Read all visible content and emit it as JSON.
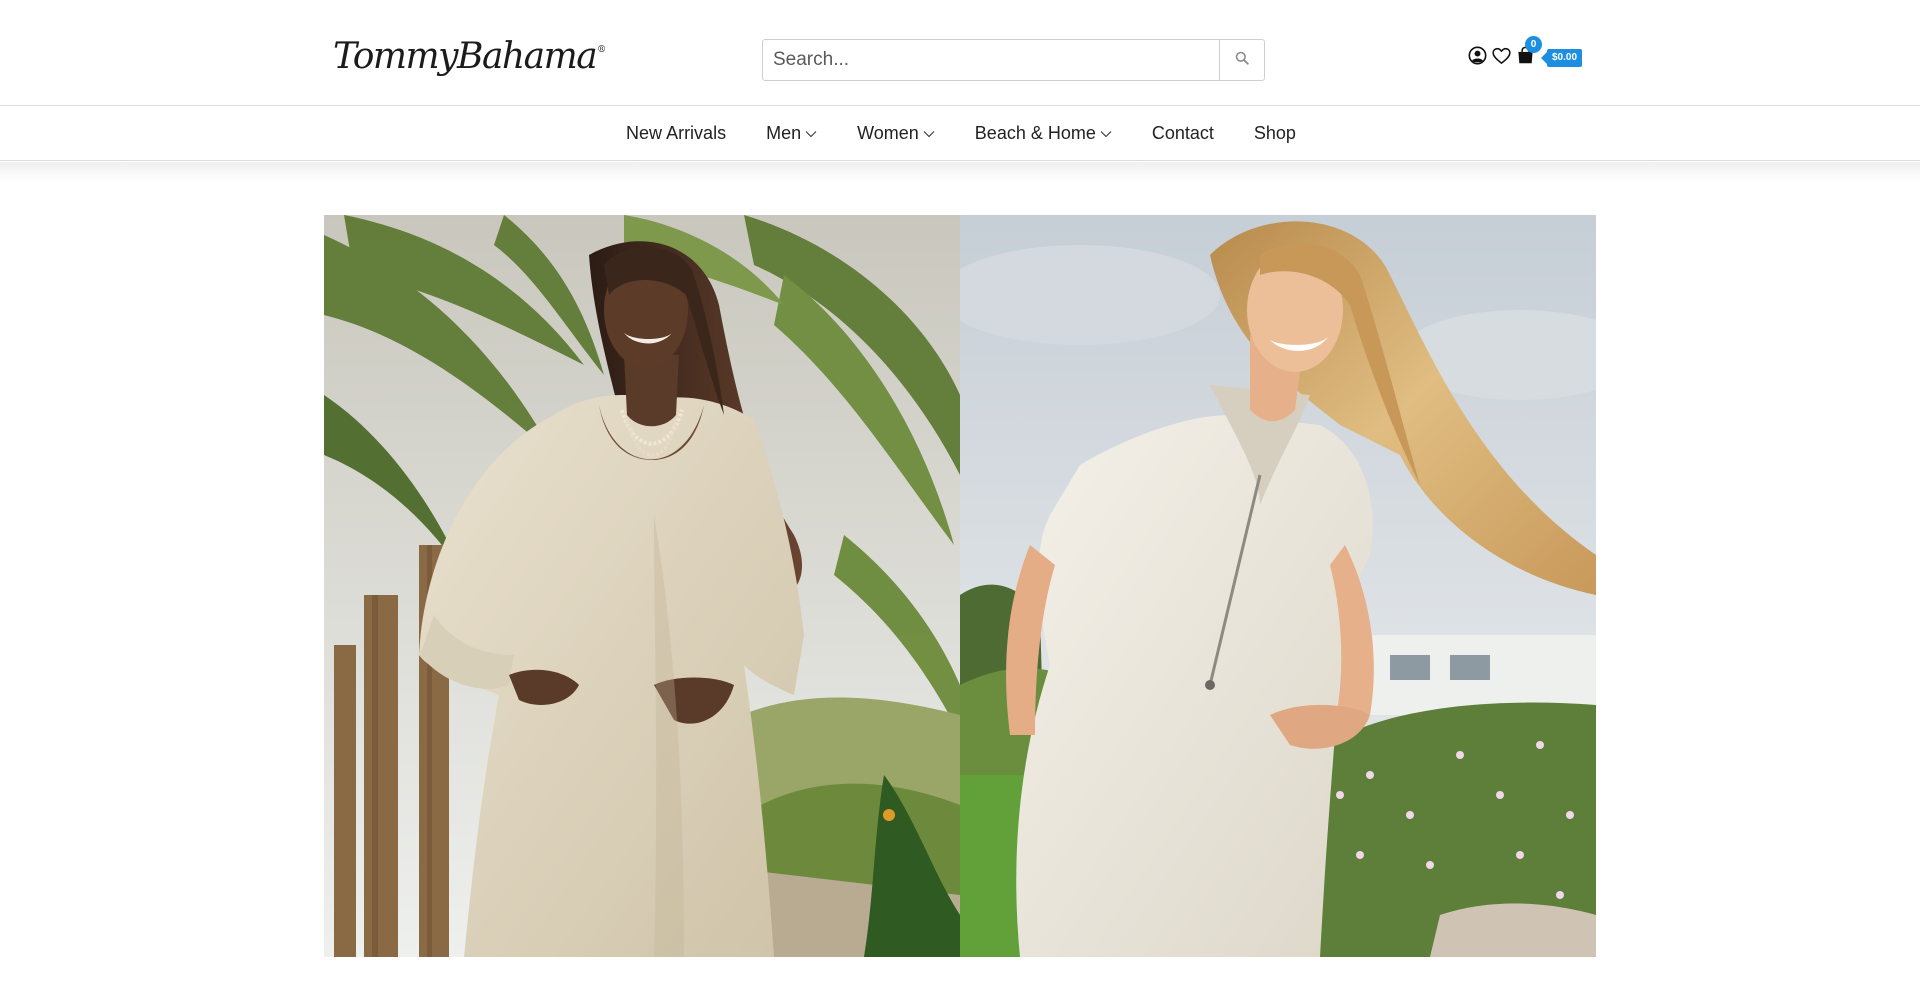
{
  "header": {
    "brand": "TommyBahama",
    "registered_mark": "®",
    "search": {
      "placeholder": "Search...",
      "value": ""
    },
    "icons": {
      "account": "user-circle-icon",
      "wishlist": "heart-icon",
      "cart": "shopping-bag-icon",
      "search": "search-icon"
    },
    "cart": {
      "count": "0",
      "total": "$0.00"
    }
  },
  "nav": {
    "items": [
      {
        "label": "New Arrivals",
        "dropdown": false
      },
      {
        "label": "Men",
        "dropdown": true
      },
      {
        "label": "Women",
        "dropdown": true
      },
      {
        "label": "Beach & Home",
        "dropdown": true
      },
      {
        "label": "Contact",
        "dropdown": false
      },
      {
        "label": "Shop",
        "dropdown": false
      }
    ]
  },
  "hero": {
    "images": [
      {
        "name": "woman-cream-sweater-dress-palms-photo"
      },
      {
        "name": "woman-white-zip-dress-garden-photo"
      }
    ]
  },
  "colors": {
    "accent": "#1e8fe0",
    "text": "#222222",
    "border": "#dcdcdc"
  }
}
